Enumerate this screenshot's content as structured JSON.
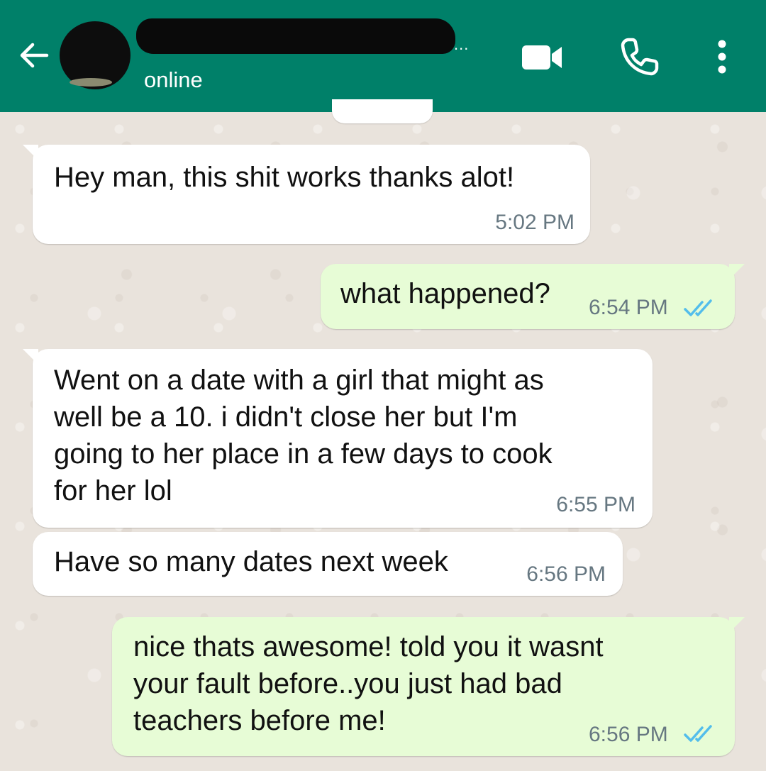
{
  "header": {
    "status": "online",
    "name_ellipsis": "..."
  },
  "icons": {
    "back": "arrow-back-icon",
    "video": "video-camera-icon",
    "call": "phone-icon",
    "menu": "more-vertical-icon"
  },
  "colors": {
    "header_bg": "#008069",
    "incoming_bubble": "#ffffff",
    "outgoing_bubble": "#e7fcd6",
    "read_ticks": "#53bdeb",
    "timestamp": "#667781"
  },
  "messages": [
    {
      "direction": "incoming",
      "text": "Hey man, this shit works thanks alot!",
      "time": "5:02 PM"
    },
    {
      "direction": "outgoing",
      "text": "what happened?",
      "time": "6:54 PM",
      "status": "read"
    },
    {
      "direction": "incoming",
      "text": "Went on a date with a girl that might as\nwell be a 10. i didn't close her but I'm\ngoing to her place in a few days to cook\nfor her lol",
      "time": "6:55 PM"
    },
    {
      "direction": "incoming",
      "text": "Have so many dates next week",
      "time": "6:56 PM"
    },
    {
      "direction": "outgoing",
      "text": "nice thats awesome! told you it wasnt\nyour fault before..you just had bad\nteachers before me!",
      "time": "6:56 PM",
      "status": "read"
    }
  ]
}
